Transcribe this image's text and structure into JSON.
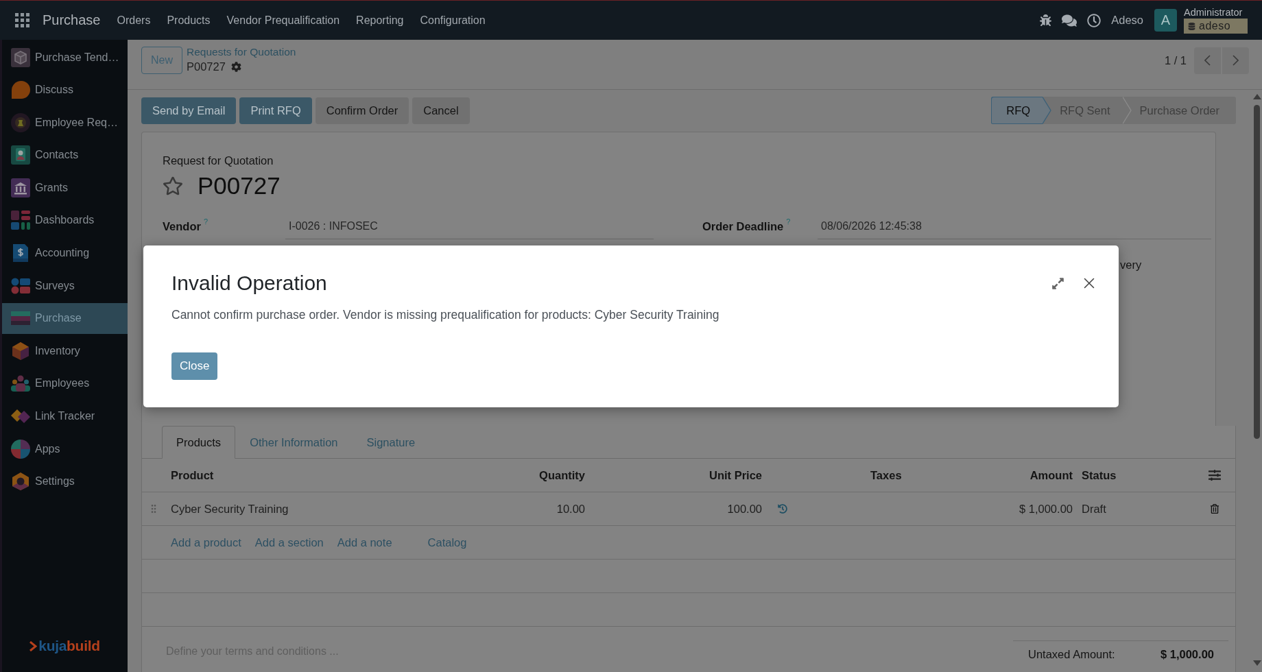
{
  "navbar": {
    "app_name": "Purchase",
    "menu": [
      "Orders",
      "Products",
      "Vendor Prequalification",
      "Reporting",
      "Configuration"
    ],
    "company": "Adeso",
    "avatar_letter": "A",
    "user_name": "Administrator",
    "database": "adeso"
  },
  "sidebar": {
    "items": [
      {
        "label": "Purchase Tend…",
        "selected": false
      },
      {
        "label": "Discuss",
        "selected": false
      },
      {
        "label": "Employee Req…",
        "selected": false
      },
      {
        "label": "Contacts",
        "selected": false
      },
      {
        "label": "Grants",
        "selected": false
      },
      {
        "label": "Dashboards",
        "selected": false
      },
      {
        "label": "Accounting",
        "selected": false
      },
      {
        "label": "Surveys",
        "selected": false
      },
      {
        "label": "Purchase",
        "selected": true
      },
      {
        "label": "Inventory",
        "selected": false
      },
      {
        "label": "Employees",
        "selected": false
      },
      {
        "label": "Link Tracker",
        "selected": false
      },
      {
        "label": "Apps",
        "selected": false
      },
      {
        "label": "Settings",
        "selected": false
      }
    ],
    "logo": {
      "parts": [
        "kuja",
        "build"
      ]
    }
  },
  "control_panel": {
    "new_button": "New",
    "breadcrumb": "Requests for Quotation",
    "record_name": "P00727",
    "pager": "1 / 1"
  },
  "action_buttons": [
    {
      "label": "Send by Email",
      "kind": "primary"
    },
    {
      "label": "Print RFQ",
      "kind": "primary"
    },
    {
      "label": "Confirm Order",
      "kind": "secondary"
    },
    {
      "label": "Cancel",
      "kind": "secondary"
    }
  ],
  "status_stages": [
    {
      "label": "RFQ",
      "selected": true
    },
    {
      "label": "RFQ Sent",
      "selected": false
    },
    {
      "label": "Purchase Order",
      "selected": false
    }
  ],
  "form": {
    "subtitle": "Request for Quotation",
    "favorite": false,
    "title": "P00727",
    "fields": [
      {
        "label": "Vendor",
        "help": "?",
        "value": "I-0026 : INFOSEC"
      },
      {
        "label": "Order Deadline",
        "help": "?",
        "value": "08/06/2026 12:45:38"
      }
    ],
    "covered_text": "very"
  },
  "notebook": {
    "tabs": [
      {
        "label": "Products",
        "selected": true
      },
      {
        "label": "Other Information",
        "selected": false
      },
      {
        "label": "Signature",
        "selected": false
      }
    ],
    "columns": [
      "Product",
      "Quantity",
      "Unit Price",
      "Taxes",
      "Amount",
      "Status"
    ],
    "rows": [
      {
        "product": "Cyber Security Training",
        "quantity": "10.00",
        "unit_price": "100.00",
        "amount": "$ 1,000.00",
        "status": "Draft"
      }
    ],
    "add_links": [
      "Add a product",
      "Add a section",
      "Add a note",
      "Catalog"
    ],
    "notes_placeholder": "Define your terms and conditions ...",
    "totals": [
      {
        "label": "Untaxed Amount:",
        "value": "$ 1,000.00"
      }
    ]
  },
  "dialog": {
    "title": "Invalid Operation",
    "message": "Cannot confirm purchase order. Vendor is missing prequalification for products: Cyber Security Training",
    "button": "Close"
  }
}
